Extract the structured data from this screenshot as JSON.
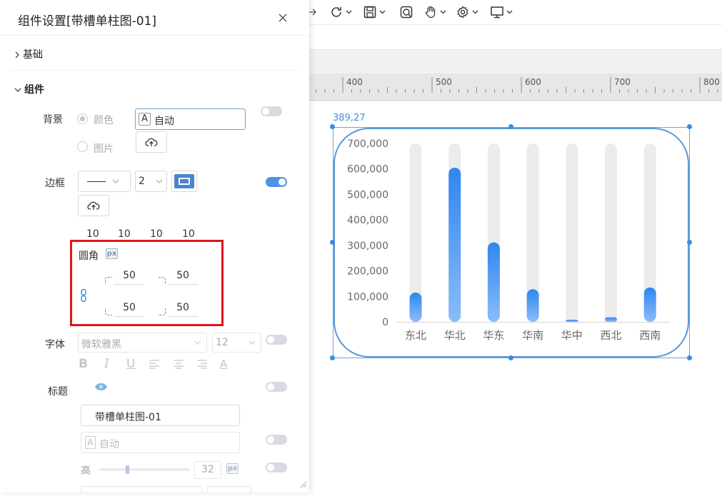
{
  "ruler": {
    "marks": [
      "400",
      "500",
      "600",
      "700",
      "800"
    ]
  },
  "widget": {
    "coord_label": "389,27"
  },
  "chart_data": {
    "type": "bar",
    "categories": [
      "东北",
      "华北",
      "华东",
      "华南",
      "华中",
      "西北",
      "西南"
    ],
    "values": [
      115000,
      605000,
      312000,
      128000,
      2000,
      18000,
      135000
    ],
    "ylim": [
      0,
      700000
    ],
    "yticks": [
      "700,000",
      "600,000",
      "500,000",
      "400,000",
      "300,000",
      "200,000",
      "100,000",
      "0"
    ],
    "track_color": "#ececec",
    "bar_color_top": "#2f86f0",
    "bar_color_bottom": "#8cbcf8"
  },
  "panel": {
    "title": "组件设置[带槽单柱图-01]",
    "section_basic": "基础",
    "section_component": "组件",
    "background": {
      "label": "背景",
      "option_color": "颜色",
      "option_image": "图片",
      "color_value": "自动"
    },
    "border": {
      "label": "边框",
      "width": "2",
      "accent_color": "#4a86d0"
    },
    "radius": {
      "values_top": [
        "10",
        "10",
        "10",
        "10"
      ],
      "label": "圆角",
      "unit": "px",
      "top_left": "50",
      "top_right": "50",
      "bottom_left": "50",
      "bottom_right": "50"
    },
    "font": {
      "label": "字体",
      "family": "微软雅黑",
      "size": "12",
      "format_icons": [
        "bold-icon",
        "italic-icon",
        "underline-icon",
        "align-left-icon",
        "align-center-icon",
        "align-right-icon",
        "font-color-icon"
      ]
    },
    "title_row": {
      "label": "标题",
      "text": "带槽单柱图-01",
      "color_value": "自动",
      "height_label": "高",
      "height_value": "32",
      "unit": "px"
    }
  }
}
